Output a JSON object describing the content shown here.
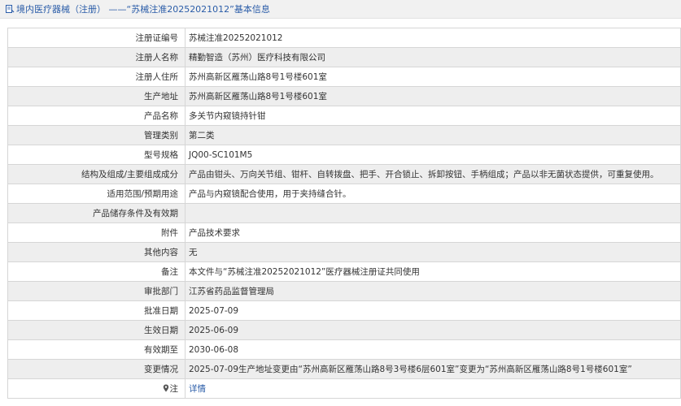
{
  "header": {
    "title": "境内医疗器械（注册） ——“苏械注准20252021012”基本信息"
  },
  "rows": [
    {
      "label": "注册证编号",
      "value": "苏械注准20252021012"
    },
    {
      "label": "注册人名称",
      "value": "精勤智造（苏州）医疗科技有限公司"
    },
    {
      "label": "注册人住所",
      "value": "苏州高新区雁荡山路8号1号楼601室"
    },
    {
      "label": "生产地址",
      "value": "苏州高新区雁荡山路8号1号楼601室"
    },
    {
      "label": "产品名称",
      "value": "多关节内窥镜持针钳"
    },
    {
      "label": "管理类别",
      "value": "第二类"
    },
    {
      "label": "型号规格",
      "value": "JQ00-SC101M5"
    },
    {
      "label": "结构及组成/主要组成成分",
      "value": "产品由钳头、万向关节组、钳杆、自转拨盘、把手、开合锁止、拆卸按钮、手柄组成；产品以非无菌状态提供，可重复使用。"
    },
    {
      "label": "适用范围/预期用途",
      "value": "产品与内窥镜配合使用，用于夹持缝合针。"
    },
    {
      "label": "产品储存条件及有效期",
      "value": ""
    },
    {
      "label": "附件",
      "value": "产品技术要求"
    },
    {
      "label": "其他内容",
      "value": "无"
    },
    {
      "label": "备注",
      "value": "本文件与“苏械注准20252021012”医疗器械注册证共同使用"
    },
    {
      "label": "审批部门",
      "value": "江苏省药品监督管理局"
    },
    {
      "label": "批准日期",
      "value": "2025-07-09"
    },
    {
      "label": "生效日期",
      "value": "2025-06-09"
    },
    {
      "label": "有效期至",
      "value": "2030-06-08"
    },
    {
      "label": "变更情况",
      "value": "2025-07-09生产地址变更由“苏州高新区雁荡山路8号3号楼6层601室”变更为“苏州高新区雁荡山路8号1号楼601室”"
    }
  ],
  "note_row": {
    "label": "注",
    "link": "详情",
    "icon": "pin-icon"
  },
  "colors": {
    "title_text": "#2a5ca8",
    "row_alt": "#eeeeee",
    "border": "#d6d6d6"
  }
}
